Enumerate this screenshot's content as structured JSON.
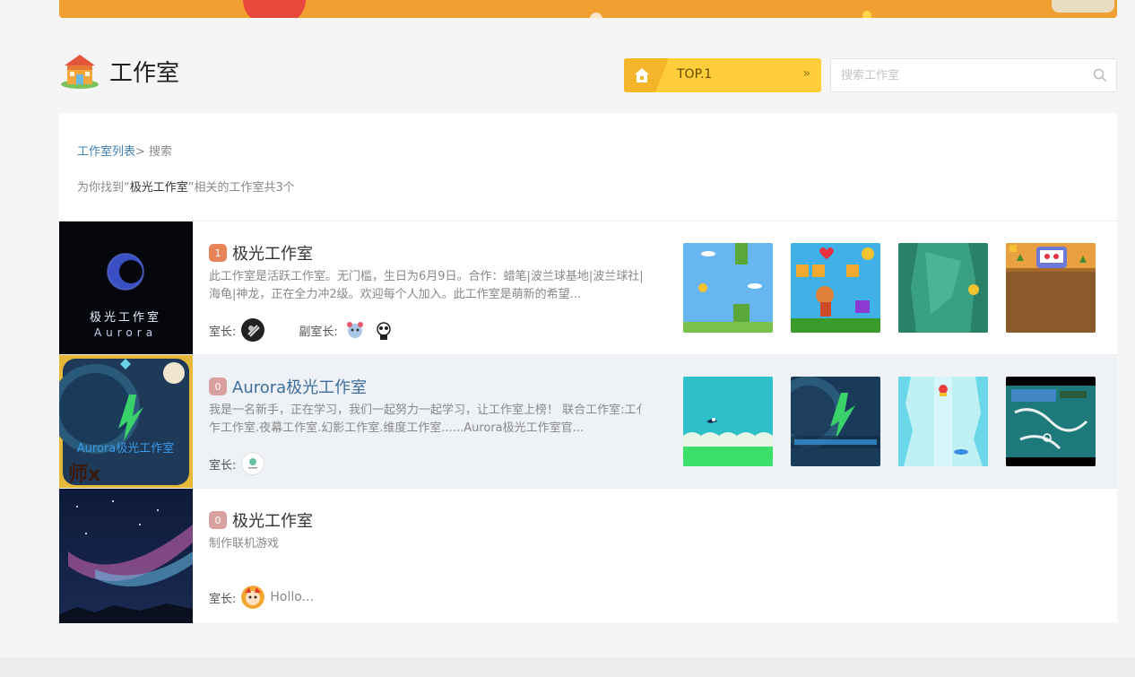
{
  "header": {
    "title": "工作室",
    "top_button_label": "TOP.1",
    "top_button_arrow": "»",
    "search_placeholder": "搜索工作室"
  },
  "breadcrumb": {
    "link": "工作室列表",
    "separator": "> ",
    "current": "搜索"
  },
  "result": {
    "prefix": "为你找到“",
    "keyword": "极光工作室",
    "suffix": "”相关的工作室共3个"
  },
  "labels": {
    "owner": "室长:",
    "vice_owner": "副室长:"
  },
  "studios": [
    {
      "name": "极光工作室",
      "level": "1",
      "description": "此工作室是活跃工作室。无门槛，生日为6月9日。合作：蜡笔|波兰球基地|波兰球社|海龟|神龙，正在全力冲2级。欢迎每个人加入。此工作室是萌新的希望...",
      "cover_text": "极光工作室",
      "cover_subtext": "Aurora"
    },
    {
      "name": "Aurora极光工作室",
      "level": "0",
      "description": "我是一名新手，正在学习，我们一起努力一起学习，让工作室上榜！ 联合工作室:工亻乍工作室.夜幕工作室.幻影工作室.维度工作室......Aurora极光工作室官...",
      "cover_text": "Aurora极光工作室",
      "cover_subtext": "师x"
    },
    {
      "name": "极光工作室",
      "level": "0",
      "description": "制作联机游戏",
      "owner_name": "Hollo..."
    }
  ],
  "colors": {
    "accent_yellow": "#ffce3a",
    "link_blue": "#3f7fb4",
    "level1": "#e8845a",
    "level0": "#d9a0a0"
  }
}
